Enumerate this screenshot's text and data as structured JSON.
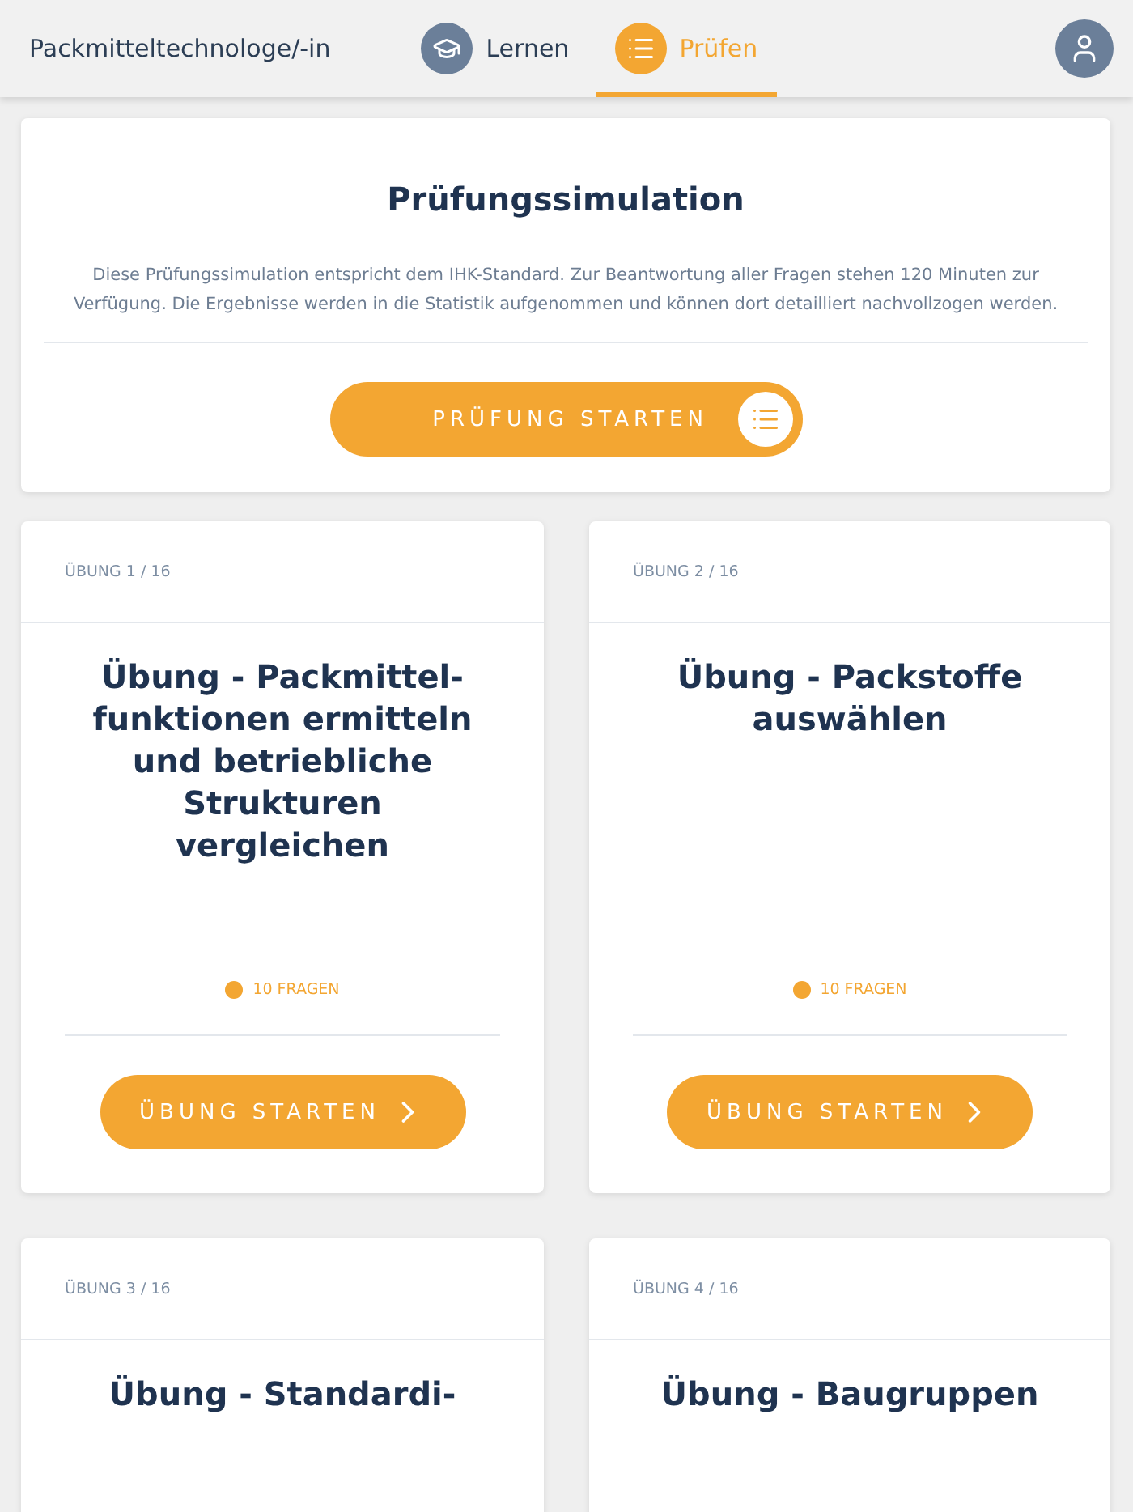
{
  "header": {
    "title": "Packmitteltechnologe/-in",
    "tabs": [
      {
        "label": "Lernen",
        "selected": false
      },
      {
        "label": "Prüfen",
        "selected": true
      }
    ]
  },
  "simulation": {
    "title": "Prüfungssimulation",
    "text": "Diese Prüfungssimulation entspricht dem IHK-Standard. Zur Beantwortung aller Fragen stehen 120 Minuten zur Verfügung. Die Ergebnisse werden in die Statistik aufgenommen und können dort detailliert nachvollzogen werden.",
    "button": "PRÜFUNG STARTEN"
  },
  "exercises": [
    {
      "counter": "ÜBUNG 1 / 16",
      "title": "Übung - Packmittel-funktionen ermitteln und betriebliche Strukturen vergleichen",
      "questions": "10 FRAGEN",
      "button": "ÜBUNG STARTEN"
    },
    {
      "counter": "ÜBUNG 2 / 16",
      "title": "Übung - Packstoffe auswählen",
      "questions": "10 FRAGEN",
      "button": "ÜBUNG STARTEN"
    },
    {
      "counter": "ÜBUNG 3 / 16",
      "title": "Übung - Standardi-"
    },
    {
      "counter": "ÜBUNG 4 / 16",
      "title": "Übung - Baugruppen"
    }
  ]
}
